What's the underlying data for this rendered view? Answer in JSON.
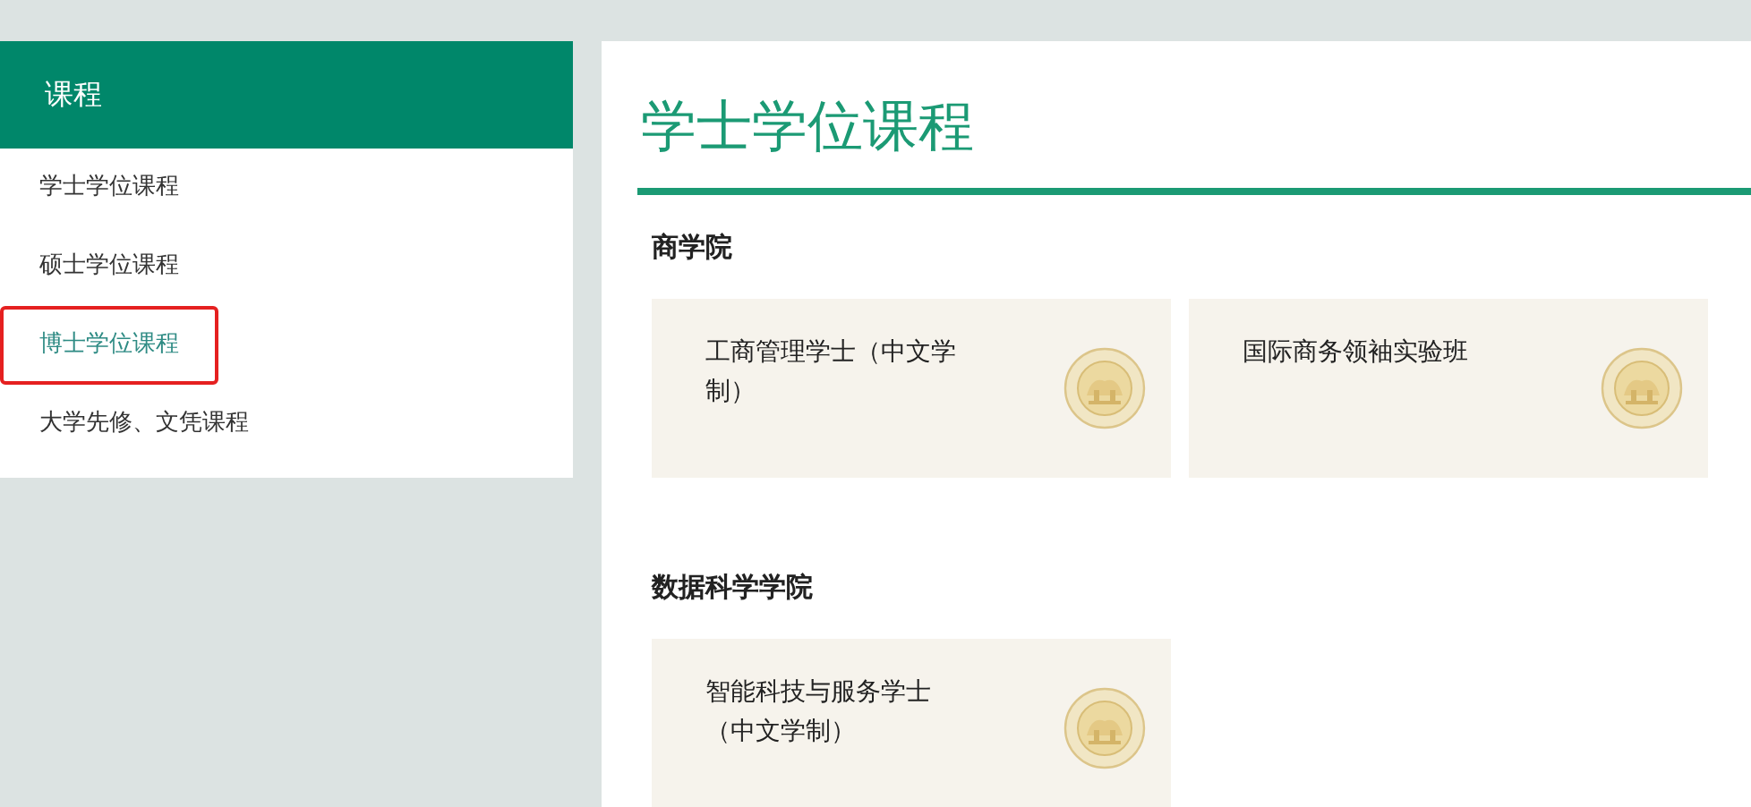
{
  "sidebar": {
    "title": "课程",
    "items": [
      {
        "label": "学士学位课程",
        "selected": false,
        "annotated": false
      },
      {
        "label": "硕士学位课程",
        "selected": false,
        "annotated": false
      },
      {
        "label": "博士学位课程",
        "selected": true,
        "annotated": true
      },
      {
        "label": "大学先修、文凭课程",
        "selected": false,
        "annotated": false
      }
    ]
  },
  "main": {
    "title": "学士学位课程",
    "sections": [
      {
        "heading": "商学院",
        "cards": [
          {
            "title": "工商管理学士（中文学制）"
          },
          {
            "title": "国际商务领袖实验班"
          }
        ]
      },
      {
        "heading": "数据科学学院",
        "cards": [
          {
            "title": "智能科技与服务学士（中文学制）"
          }
        ]
      }
    ]
  }
}
